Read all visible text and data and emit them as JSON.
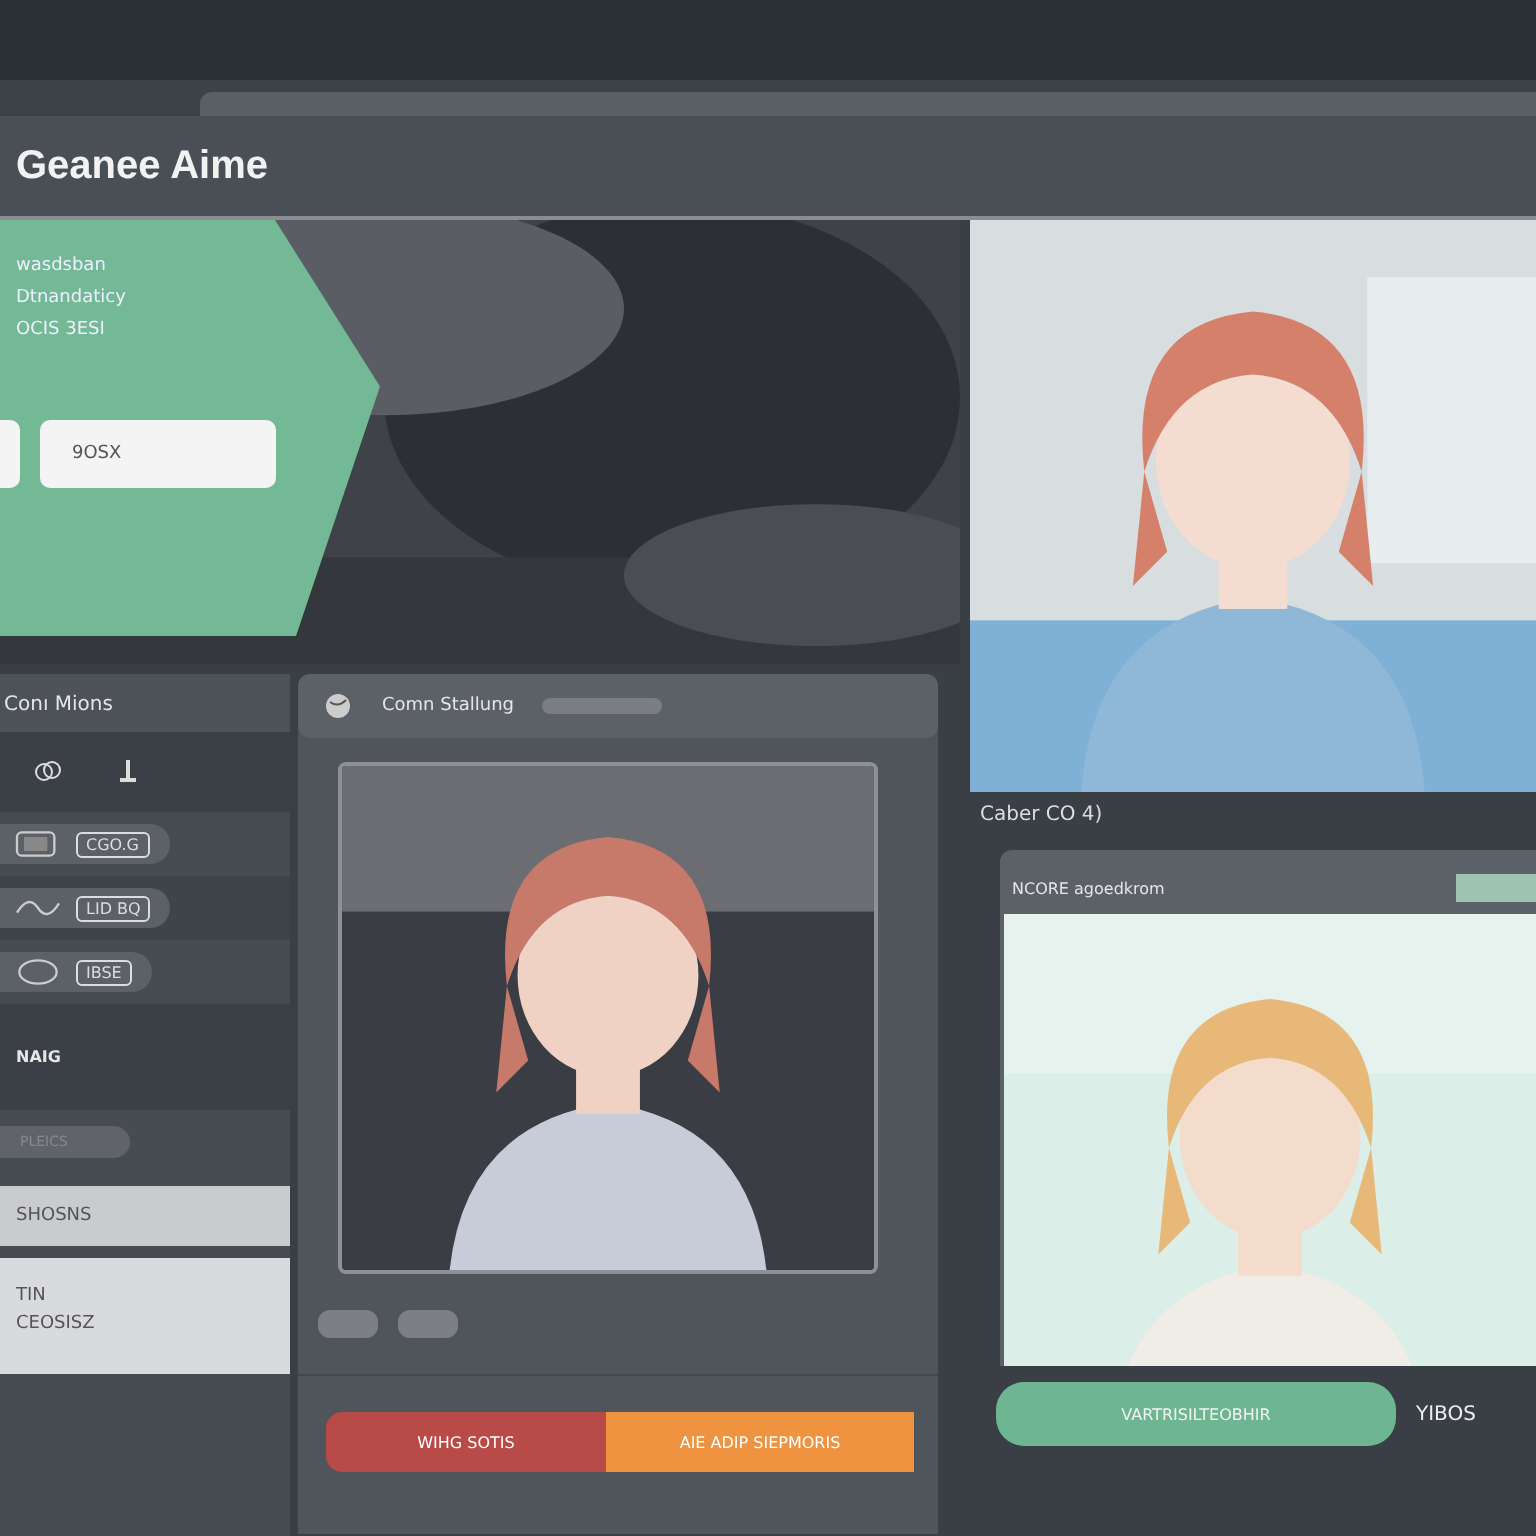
{
  "header": {
    "title": "Geanee Aime"
  },
  "hero": {
    "kind": "picture",
    "lines": [
      "wasdsban",
      "Dtnandaticy",
      "OCIS 3ESI"
    ],
    "buttons": [
      "9OSX"
    ]
  },
  "sidebar": {
    "title": "Conı Mions",
    "toggles": [
      {
        "label": "CGO.G"
      },
      {
        "label": "LID BQ"
      },
      {
        "label": "IBSE"
      }
    ],
    "section": "NAIG",
    "pill": "PLEICS",
    "panels": [
      [
        "SHOSNS"
      ],
      [
        "TIN",
        "CEOSISZ"
      ]
    ]
  },
  "card": {
    "title": "Comn Stallung",
    "buttons": [
      {
        "label": "WIHG SOTIS",
        "color": "#b84a48"
      },
      {
        "label": "AIE ADIP SIEPMORIS",
        "color": "#ef9340"
      }
    ]
  },
  "caption": "Caber CO 4)",
  "right_card": {
    "title": "NCORE agoedkrom"
  },
  "actions": {
    "primary": "VARTRISILTEOBHIR",
    "secondary": "YIBOS"
  }
}
